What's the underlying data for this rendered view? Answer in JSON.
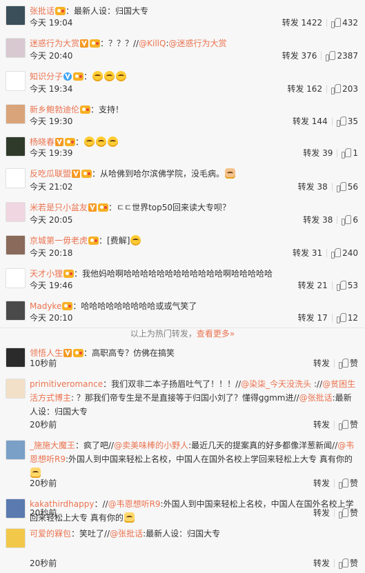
{
  "hot_comments": [
    {
      "user": "张批话",
      "text": "：最新人设：归国大专",
      "time": "今天 19:04",
      "repost": "转发 1422",
      "likes": "432",
      "badges": [
        "level"
      ],
      "avatar": "#3a4f5a"
    },
    {
      "user": "迷惑行为大赏",
      "text": "：？？？//@KillQ:@迷惑行为大赏",
      "time": "今天 20:40",
      "repost": "转发 376",
      "likes": "2387",
      "badges": [
        "gold",
        "level"
      ],
      "avatar": "#d8c8d0"
    },
    {
      "user": "知识分子",
      "text": "：",
      "time": "今天 19:34",
      "repost": "转发 162",
      "likes": "203",
      "badges": [
        "blue",
        "level"
      ],
      "emojis": 3,
      "avatar": "#ffffff"
    },
    {
      "user": "新乡鲍勃迪伦",
      "text": "：支持！",
      "time": "今天 19:30",
      "repost": "转发 144",
      "likes": "35",
      "badges": [
        "level"
      ],
      "avatar": "#d9a47a"
    },
    {
      "user": "杨晓春",
      "text": "：",
      "time": "今天 19:39",
      "repost": "转发 39",
      "likes": "1",
      "badges": [
        "gold",
        "level"
      ],
      "emojis": 3,
      "avatar": "#2f3a2a"
    },
    {
      "user": "反吃瓜联盟",
      "text": "：从哈佛到哈尔滨佛学院，没毛病。",
      "time": "今天 21:02",
      "repost": "转发 38",
      "likes": "56",
      "badges": [
        "gold",
        "level"
      ],
      "emojis": 1,
      "emoji_kind": "cat",
      "avatar": "#ffffff"
    },
    {
      "user": "米若是只小盆友",
      "text": "：ㄷㄷ世界top50回来读大专呗？",
      "time": "今天 20:05",
      "repost": "转发 38",
      "likes": "6",
      "badges": [
        "gold",
        "level"
      ],
      "avatar": "#f0d6e0"
    },
    {
      "user": "京城第一毋老虎",
      "text": "：[费解]",
      "time": "今天 20:18",
      "repost": "转发 31",
      "likes": "240",
      "badges": [
        "level"
      ],
      "emojis": 1,
      "avatar": "#8a6a5a"
    },
    {
      "user": "天才小狸",
      "text": "：我他妈哈啊哈哈哈哈哈哈哈哈哈哈哈哈啊哈哈哈哈哈",
      "time": "今天 19:46",
      "repost": "转发 21",
      "likes": "53",
      "badges": [
        "level"
      ],
      "avatar": "#ffffff"
    },
    {
      "user": "Madyke",
      "text": "：哈哈哈哈哈哈哈哈哈或或气笑了",
      "time": "今天 20:10",
      "repost": "转发 17",
      "likes": "12",
      "badges": [
        "level"
      ],
      "avatar": "#4a4a4a"
    }
  ],
  "more_bar": {
    "prefix": "以上为热门转发，",
    "link": "查看更多»"
  },
  "recent_comments": [
    {
      "user": "领悟人生",
      "text": "：高职高专？仿佛在搞笑",
      "time": "10秒前",
      "repost": "转发",
      "like": "赞",
      "badges": [
        "gold",
        "level"
      ],
      "avatar": "#2b2b2b"
    },
    {
      "user": "primitiveromance",
      "text": "：我们双非二本子扬眉吐气了！！！//@染柒_今天没洗头 ://@贫困生活方式博主: ？那我们帝专生是不是直接等于归国小刘了？懂得ggmm进//@张批话:最新人设：归国大专",
      "time": "20秒前",
      "repost": "转发",
      "like": "赞",
      "badges": [],
      "avatar": "#f3e0c8"
    },
    {
      "user": "_施施大魔王",
      "text": "：疯了吧//@卖美味棒的小野人:最近几天的提案真的好多都像洋葱新闻//@韦恩想听R9:外国人到中国来轻松上名校，中国人在国外名校上学回来轻松上大专 真有你的",
      "time": "20秒前",
      "repost": "转发",
      "like": "赞",
      "badges": [],
      "emojis": 1,
      "emoji_kind": "hand",
      "avatar": "#7aa0c8"
    },
    {
      "user": "kakathirdhappy",
      "text": "：//@韦恩想听R9:外国人到中国来轻松上名校，中国人在国外名校上学回来轻松上大专 真有你的",
      "time": "20秒前",
      "repost": "转发",
      "like": "赞",
      "badges": [],
      "emojis": 1,
      "emoji_kind": "hand",
      "avatar": "#5a7ab0"
    },
    {
      "user": "可爱的槑包",
      "text": "：笑吐了//@张批话:最新人设：归国大专",
      "time": "20秒前",
      "repost": "转发",
      "like": "赞",
      "badges": [],
      "avatar": "#f2c84a"
    }
  ]
}
